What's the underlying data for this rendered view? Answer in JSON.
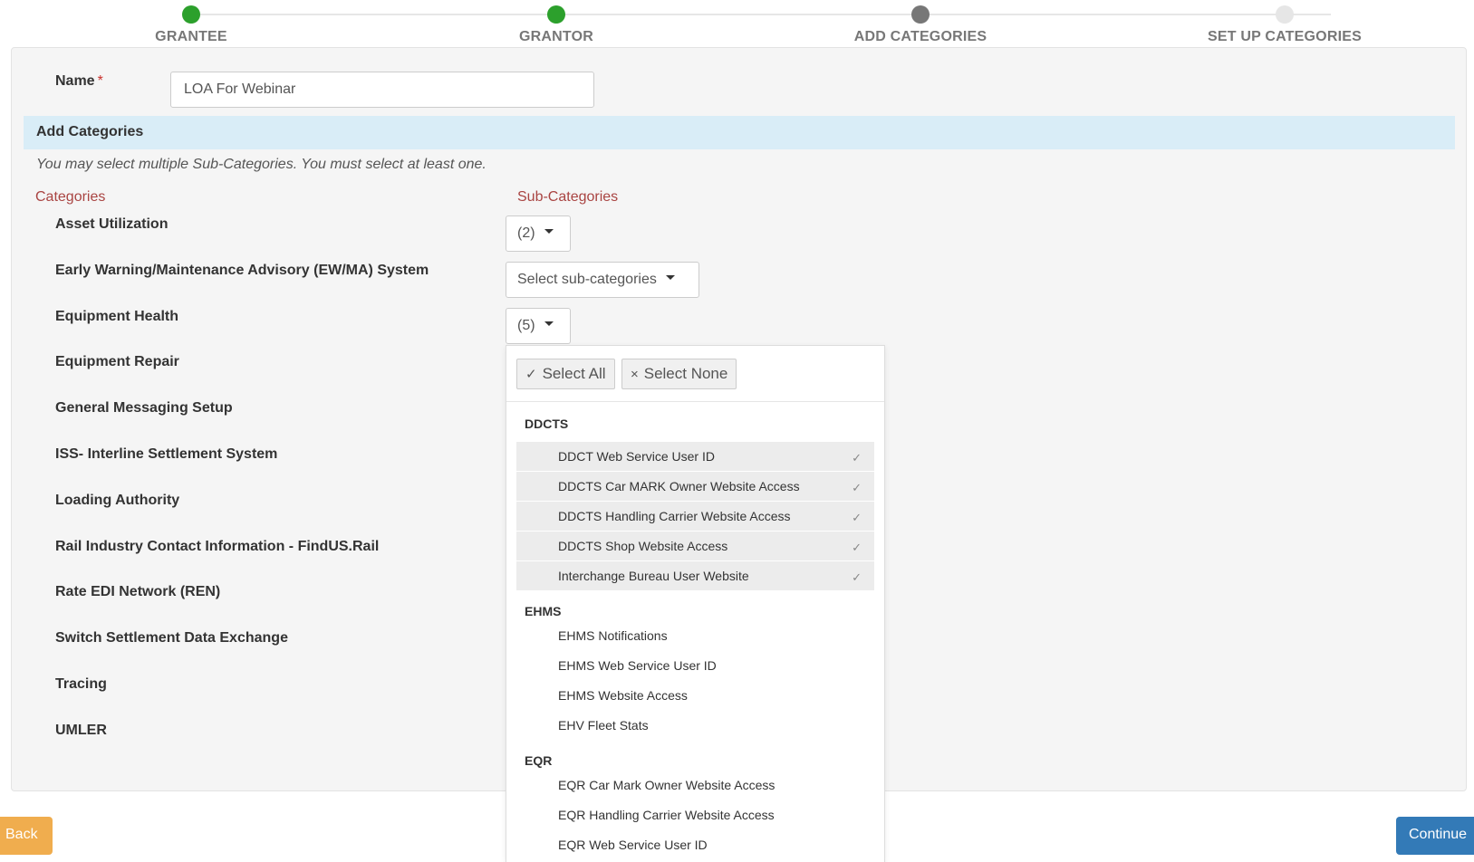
{
  "stepper": {
    "steps": [
      {
        "label": "GRANTEE",
        "color": "#2ca02c"
      },
      {
        "label": "GRANTOR",
        "color": "#2ca02c"
      },
      {
        "label": "ADD CATEGORIES",
        "color": "#777777"
      },
      {
        "label": "SET UP CATEGORIES",
        "color": "#e6e6e6"
      }
    ]
  },
  "form": {
    "name_label": "Name",
    "required_marker": "*",
    "name_value": "LOA For Webinar"
  },
  "section": {
    "title": "Add Categories",
    "note": "You may select multiple Sub-Categories. You must select at least one.",
    "categories_header": "Categories",
    "subcategories_header": "Sub-Categories"
  },
  "categories": [
    {
      "label": "Asset Utilization",
      "dropdown": "(2)"
    },
    {
      "label": "Early Warning/Maintenance Advisory (EW/MA) System",
      "dropdown": "Select sub-categories"
    },
    {
      "label": "Equipment Health",
      "dropdown": "(5)"
    },
    {
      "label": "Equipment Repair"
    },
    {
      "label": "General Messaging Setup"
    },
    {
      "label": "ISS- Interline Settlement System"
    },
    {
      "label": "Loading Authority"
    },
    {
      "label": "Rail Industry Contact Information - FindUS.Rail"
    },
    {
      "label": "Rate EDI Network (REN)"
    },
    {
      "label": "Switch Settlement Data Exchange"
    },
    {
      "label": "Tracing"
    },
    {
      "label": "UMLER"
    }
  ],
  "dropdown_menu": {
    "select_all": "Select All",
    "select_all_icon": "✓",
    "select_none": "Select None",
    "select_none_icon": "×",
    "check_mark": "✓",
    "groups": [
      {
        "name": "DDCTS",
        "options": [
          {
            "label": "DDCT Web Service User ID",
            "selected": true
          },
          {
            "label": "DDCTS Car MARK Owner Website Access",
            "selected": true
          },
          {
            "label": "DDCTS Handling Carrier Website Access",
            "selected": true
          },
          {
            "label": "DDCTS Shop Website Access",
            "selected": true
          },
          {
            "label": "Interchange Bureau User Website",
            "selected": true
          }
        ]
      },
      {
        "name": "EHMS",
        "options": [
          {
            "label": "EHMS Notifications",
            "selected": false
          },
          {
            "label": "EHMS Web Service User ID",
            "selected": false
          },
          {
            "label": "EHMS Website Access",
            "selected": false
          },
          {
            "label": "EHV Fleet Stats",
            "selected": false
          }
        ]
      },
      {
        "name": "EQR",
        "options": [
          {
            "label": "EQR Car Mark Owner Website Access",
            "selected": false
          },
          {
            "label": "EQR Handling Carrier Website Access",
            "selected": false
          },
          {
            "label": "EQR Web Service User ID",
            "selected": false
          }
        ]
      }
    ]
  },
  "buttons": {
    "back": "Back",
    "continue": "Continue"
  }
}
